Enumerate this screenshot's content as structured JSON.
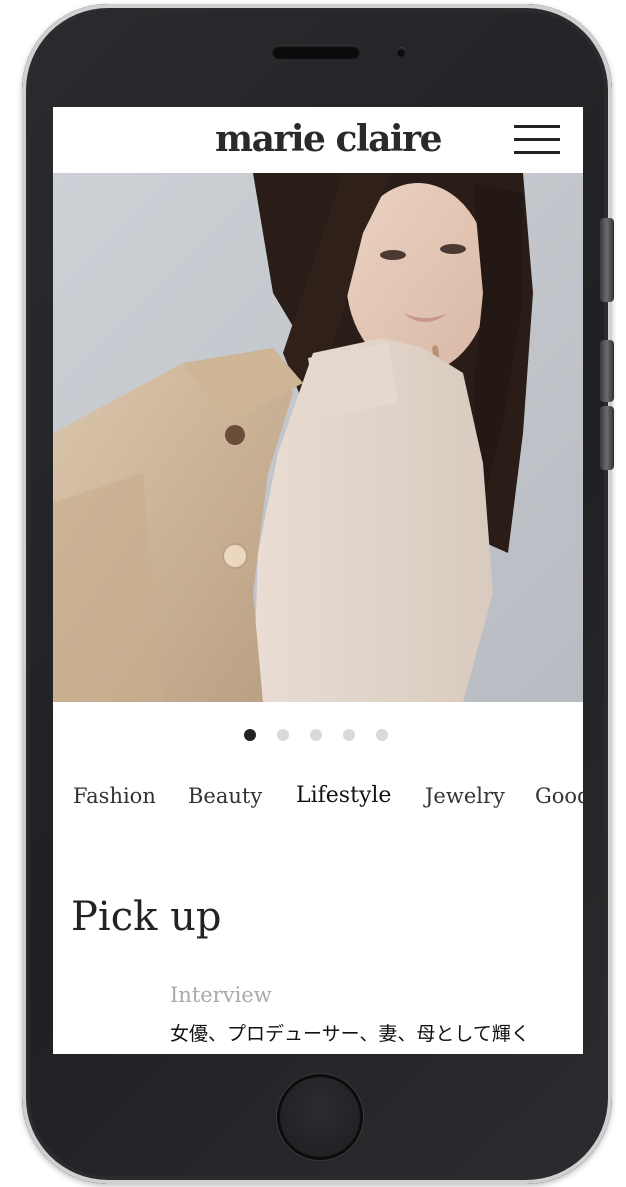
{
  "header": {
    "logo": "marie claire",
    "menu_icon": "hamburger-menu-icon"
  },
  "hero": {
    "slide_count": 5,
    "active_slide": 1
  },
  "categories": [
    {
      "label": "Fashion"
    },
    {
      "label": "Beauty"
    },
    {
      "label": "Lifestyle",
      "active": true
    },
    {
      "label": "Jewelry"
    },
    {
      "label": "Good"
    }
  ],
  "pickup": {
    "title": "Pick up",
    "article": {
      "kicker": "Interview",
      "headline": "女優、プロデューサー、妻、母として輝く"
    }
  },
  "colors": {
    "text": "#222222",
    "muted": "#aaaaaa",
    "dot_inactive": "#d9d9d9",
    "dot_active": "#222222"
  }
}
